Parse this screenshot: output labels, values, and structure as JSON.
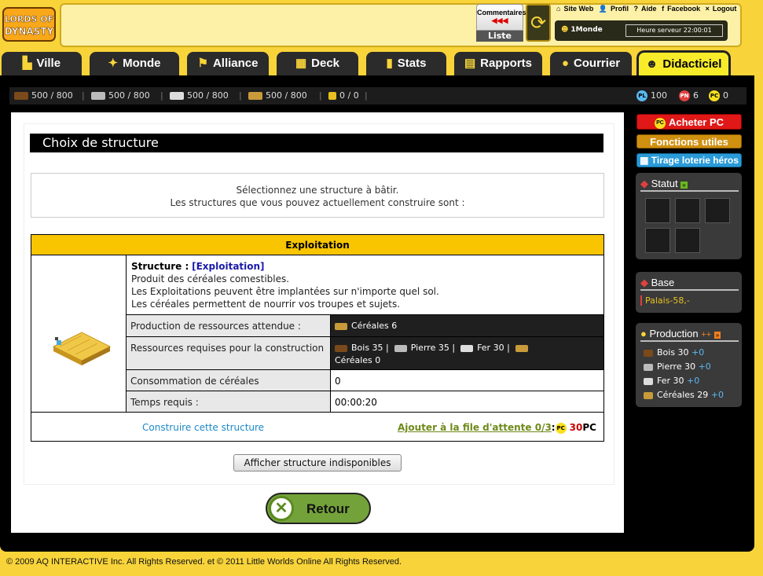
{
  "header": {
    "logo_text": "LORDS OF DYNASTY",
    "comment_btn": {
      "label": "Commentaires",
      "arrows": "◀◀◀",
      "list_label": "Liste"
    },
    "links": [
      "Site Web",
      "Profil",
      "Aide",
      "Facebook",
      "Logout"
    ],
    "world": "1Monde",
    "server_time": "Heure serveur 22:00:01"
  },
  "tabs": [
    {
      "label": "Ville",
      "icon": "town-icon"
    },
    {
      "label": "Monde",
      "icon": "world-icon"
    },
    {
      "label": "Alliance",
      "icon": "flag-icon"
    },
    {
      "label": "Deck",
      "icon": "cards-icon"
    },
    {
      "label": "Stats",
      "icon": "bar-chart-icon"
    },
    {
      "label": "Rapports",
      "icon": "scroll-icon"
    },
    {
      "label": "Courrier",
      "icon": "mail-icon"
    },
    {
      "label": "Didacticiel",
      "icon": "tutorial-icon",
      "active": true
    }
  ],
  "resources": {
    "wood": "500 / 800",
    "stone": "500 / 800",
    "iron": "500 / 800",
    "cereal": "500 / 800",
    "keys": "0 / 0",
    "pl_label": "PL",
    "pl_value": "100",
    "pn_label": "PN",
    "pn_value": "6",
    "pc_label": "PC",
    "pc_value": "0"
  },
  "page": {
    "title": "Choix de structure",
    "intro_line1": "Sélectionnez une structure à bâtir.",
    "intro_line2": "Les structures que vous pouvez actuellement construire sont :"
  },
  "structure": {
    "header": "Exploitation",
    "label": "Structure :",
    "name": "[Exploitation]",
    "desc1": "Produit des céréales comestibles.",
    "desc2": "Les Exploitations peuvent être implantées sur n'importe quel sol.",
    "desc3": "Les céréales permettent de nourrir vos troupes et sujets.",
    "production_label": "Production de ressources attendue :",
    "production_value": "Céréales  6",
    "required_label": "Ressources requises pour la construction",
    "req_wood": "Bois  35 |",
    "req_stone": "Pierre  35 |",
    "req_iron": "Fer  30 |",
    "req_cereal": "Céréales  0",
    "consumption_label": "Consommation de céréales",
    "consumption_value": "0",
    "time_label": "Temps requis :",
    "time_value": "00:00:20",
    "build_link": "Construire cette structure",
    "queue_link": "Ajouter à la file d'attente 0/3",
    "queue_colon": ":",
    "queue_cost": "30",
    "queue_unit": "PC"
  },
  "buttons": {
    "show_unavailable": "Afficher structure indisponibles",
    "back": "Retour"
  },
  "sidebar": {
    "buy_pc": "Acheter PC",
    "utilities": "Fonctions utiles",
    "lottery": "Tirage loterie héros",
    "status_title": "Statut",
    "base_title": "Base",
    "base_item": "Palais-58,-",
    "production_title": "Production",
    "production_plus": "++",
    "prod_wood": "Bois 30",
    "prod_stone": "Pierre 30",
    "prod_iron": "Fer 30",
    "prod_cereal": "Céréales 29",
    "prod_bonus": "+0"
  },
  "footer": "© 2009 AQ INTERACTIVE Inc. All Rights Reserved. et © 2011 Little Worlds Online All Rights Reserved.",
  "colors": {
    "background": "#f8d43a",
    "active_tab": "#f8ec2a",
    "table_header": "#f8c500",
    "buy_pc": "#e01818",
    "utilities": "#d09010",
    "lottery": "#2a9ad8"
  }
}
